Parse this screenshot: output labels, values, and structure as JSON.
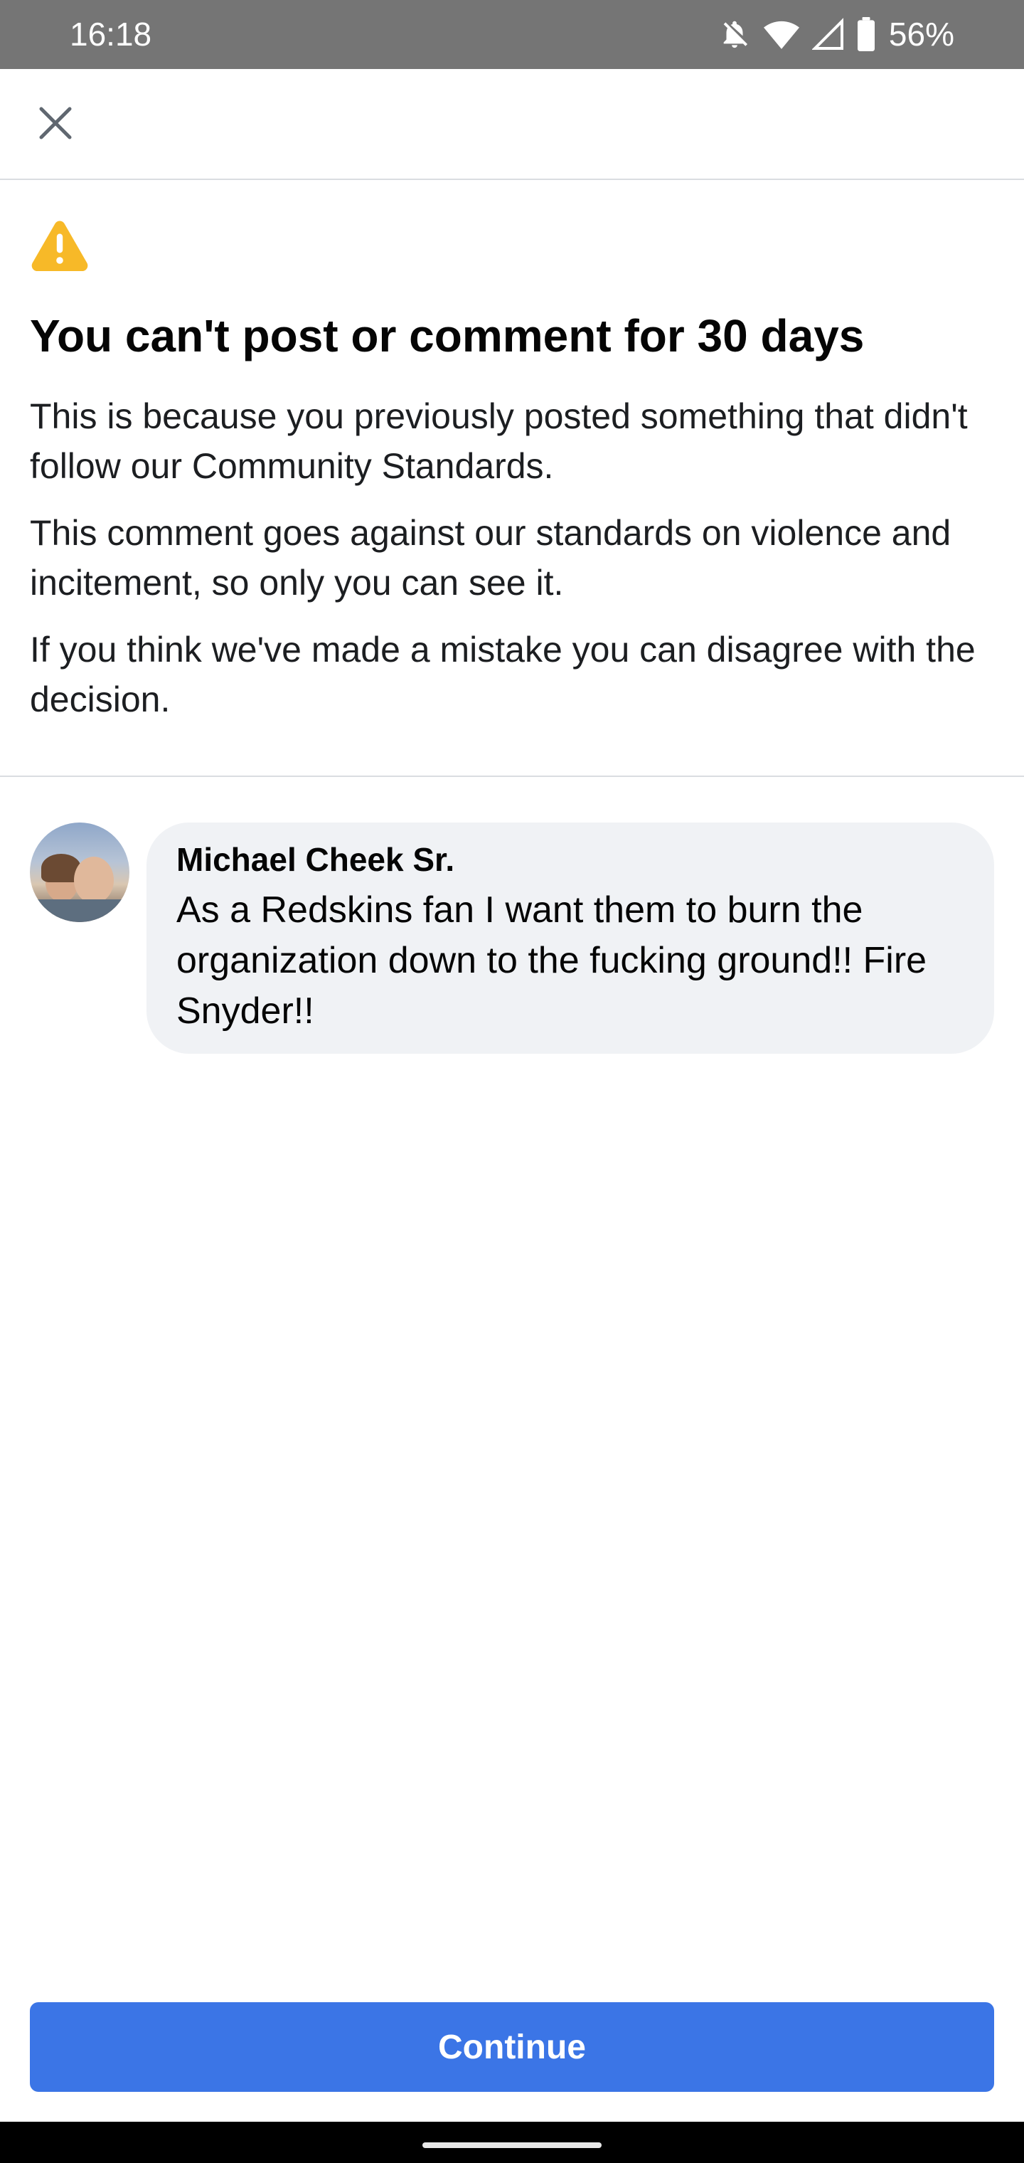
{
  "status_bar": {
    "time": "16:18",
    "battery_percent": "56%",
    "icons": [
      "bell-off-icon",
      "wifi-icon",
      "signal-icon",
      "battery-icon"
    ]
  },
  "top_bar": {
    "close_icon": "close-icon"
  },
  "notice": {
    "icon": "warning-icon",
    "icon_color": "#f7b928",
    "title": "You can't post or comment for 30 days",
    "paragraphs": [
      "This is because you previously posted something that didn't follow our Community Standards.",
      "This comment goes against our standards on violence and incitement, so only you can see it.",
      "If you think we've made a mistake you can disagree with the decision."
    ]
  },
  "comment": {
    "author": "Michael Cheek Sr.",
    "text": "As a Redskins fan I want them to burn the organization down to the fucking ground!! Fire Snyder!!"
  },
  "actions": {
    "continue_label": "Continue",
    "continue_color": "#3b75e6"
  }
}
